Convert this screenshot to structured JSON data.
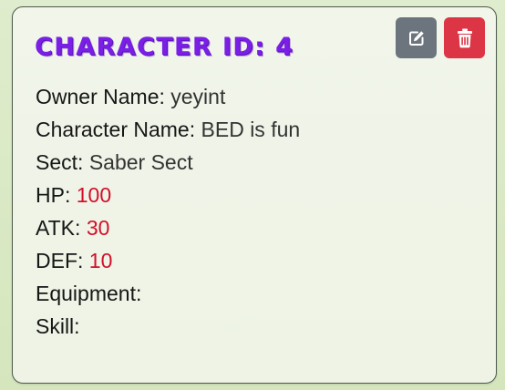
{
  "card": {
    "title": "CHARACTER ID: 4",
    "fields": {
      "owner": {
        "label": "Owner Name:",
        "value": "yeyint"
      },
      "character": {
        "label": "Character Name:",
        "value": "BED is fun"
      },
      "sect": {
        "label": "Sect:",
        "value": "Saber Sect"
      },
      "hp": {
        "label": "HP:",
        "value": "100"
      },
      "atk": {
        "label": "ATK:",
        "value": "30"
      },
      "def": {
        "label": "DEF:",
        "value": "10"
      },
      "equipment": {
        "label": "Equipment:",
        "value": ""
      },
      "skill": {
        "label": "Skill:",
        "value": ""
      }
    },
    "actions": {
      "edit_icon": "edit-icon",
      "delete_icon": "trash-icon"
    }
  },
  "colors": {
    "title": "#7a1fe6",
    "stat_value": "#d40f2a",
    "edit_button": "#6c757d",
    "delete_button": "#dc3545"
  }
}
